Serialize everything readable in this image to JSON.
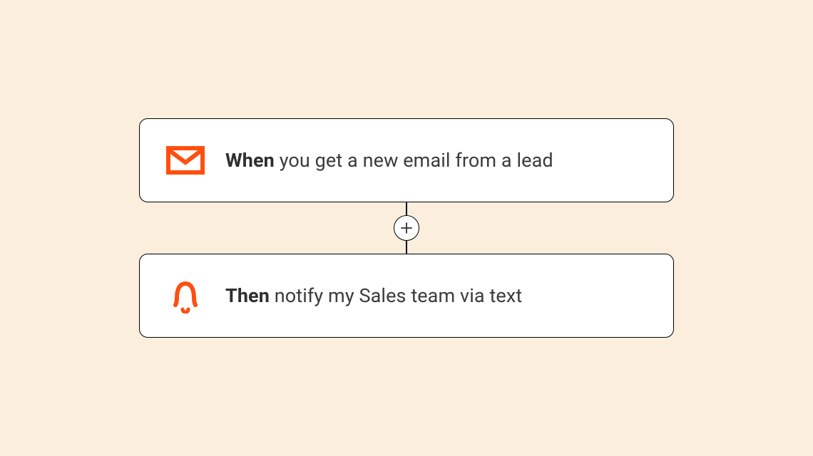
{
  "colors": {
    "accent": "#FF4F0F",
    "card_bg": "#FFFFFF",
    "page_bg": "#FCEEDD",
    "border": "#000000",
    "text": "#3B3B3B"
  },
  "flow": {
    "trigger": {
      "icon": "mail-icon",
      "keyword": "When",
      "text": "you get a new email from a lead"
    },
    "add_step_label": "Add step",
    "action": {
      "icon": "bell-icon",
      "keyword": "Then",
      "text": "notify my Sales team via text"
    }
  }
}
